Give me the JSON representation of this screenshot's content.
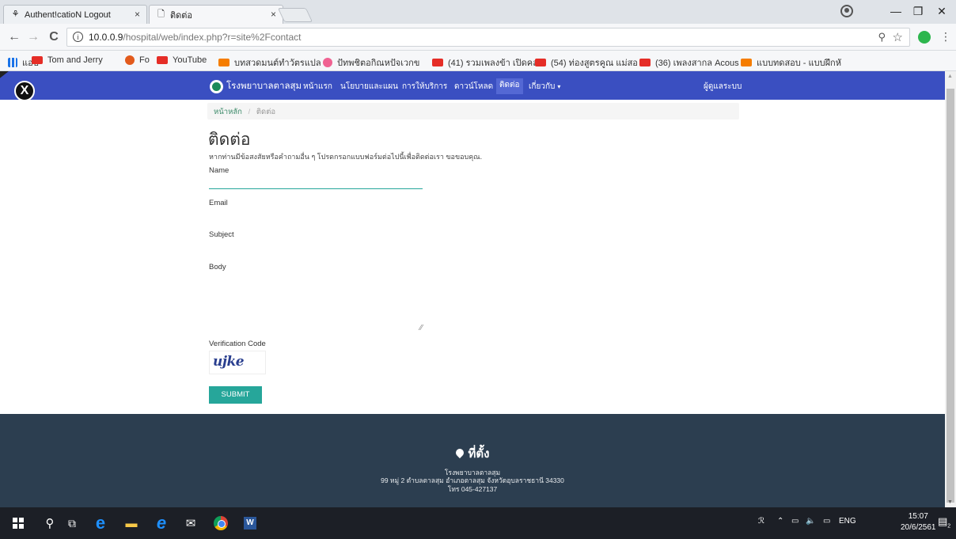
{
  "browser": {
    "tabs": [
      {
        "title": "Authent!catioN Logout",
        "close": "×"
      },
      {
        "title": "ติดต่อ",
        "close": "×"
      }
    ],
    "window_controls": {
      "minimize": "—",
      "maximize": "❐",
      "close": "✕"
    },
    "nav": {
      "back": "←",
      "forward": "→",
      "reload": "C"
    },
    "url_host": "10.0.0.9",
    "url_path": "/hospital/web/index.php?r=site%2Fcontact",
    "info_glyph": "i",
    "bookmarks": [
      {
        "label": "แอป",
        "icon": "apps-icon"
      },
      {
        "label": "Tom and Jerry",
        "icon": "youtube-icon"
      },
      {
        "label": "Fo",
        "icon": "tomato-icon"
      },
      {
        "label": "YouTube",
        "icon": "youtube-icon"
      },
      {
        "label": "บทสวดมนต์ทำวัตรแปล",
        "icon": "blogger-icon"
      },
      {
        "label": "ปัทพชิตอกิณหปัจเวกข",
        "icon": "pink-icon"
      },
      {
        "label": "(41) รวมเพลงข้า เปิดคล",
        "icon": "youtube-icon"
      },
      {
        "label": "(54) ท่องสูตรคูณ แม่สอ",
        "icon": "youtube-icon"
      },
      {
        "label": "(36) เพลงสากล Acous",
        "icon": "youtube-icon"
      },
      {
        "label": "แบบทดสอบ - แบบฝึกหั",
        "icon": "blogger-icon"
      }
    ]
  },
  "site": {
    "ribbon_glyph": "X",
    "brand": "โรงพยาบาลตาลสุม",
    "nav_items": [
      "หน้าแรก",
      "นโยบายและแผน",
      "การให้บริการ",
      "ดาวน์โหลด",
      "ติดต่อ",
      "เกี่ยวกับ"
    ],
    "dropdown_caret": "▾",
    "login": "ผู้ดูแลระบบ",
    "breadcrumb": {
      "home": "หน้าหลัก",
      "sep": "/",
      "current": "ติดต่อ"
    }
  },
  "contact": {
    "title": "ติดต่อ",
    "intro": "หากท่านมีข้อสงสัยหรือคำถามอื่น ๆ โปรดกรอกแบบฟอร์มต่อไปนี้เพื่อติดต่อเรา ขอขอบคุณ.",
    "labels": {
      "name": "Name",
      "email": "Email",
      "subject": "Subject",
      "body": "Body",
      "verification": "Verification Code"
    },
    "captcha_text": "ujke",
    "submit": "SUBMIT"
  },
  "footer": {
    "heading": "ที่ตั้ง",
    "name": "โรงพยาบาลตาลสุม",
    "address": "99 หมู่ 2 ตำบลตาลสุม อำเภอตาลสุม จังหวัดอุบลราชธานี 34330",
    "phone": "โทร 045-427137"
  },
  "taskbar": {
    "tray_lang": "ENG",
    "time": "15:07",
    "date": "20/6/2561",
    "notification_count": "2"
  },
  "colors": {
    "nav": "#3a4fc1",
    "accent": "#26a69a",
    "footer": "#2c3e50"
  }
}
